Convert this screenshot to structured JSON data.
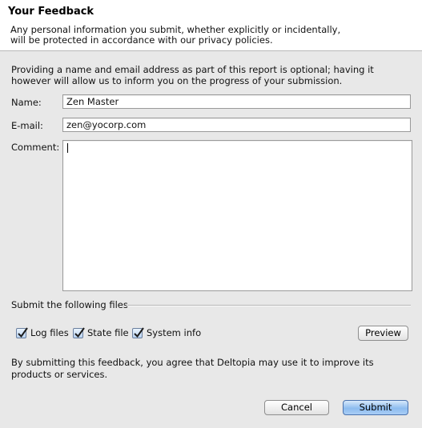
{
  "header": {
    "title": "Your Feedback",
    "description": "Any personal information you submit, whether explicitly or incidentally, will be protected in accordance with our privacy policies."
  },
  "intro": "Providing a name and email address as part of this report is optional; having it however will allow us to inform you on the progress of your submission.",
  "form": {
    "name_label": "Name:",
    "name_value": "Zen Master",
    "email_label": "E-mail:",
    "email_value": "zen@yocorp.com",
    "comment_label": "Comment:",
    "comment_value": ""
  },
  "files": {
    "section_label": "Submit the following files",
    "options": [
      {
        "label": "Log files",
        "checked": true
      },
      {
        "label": "State file",
        "checked": true
      },
      {
        "label": "System info",
        "checked": true
      }
    ],
    "preview_label": "Preview"
  },
  "agreement": "By submitting this feedback, you agree that Deltopia may use it to improve its products or services.",
  "buttons": {
    "cancel_label": "Cancel",
    "submit_label": "Submit"
  }
}
